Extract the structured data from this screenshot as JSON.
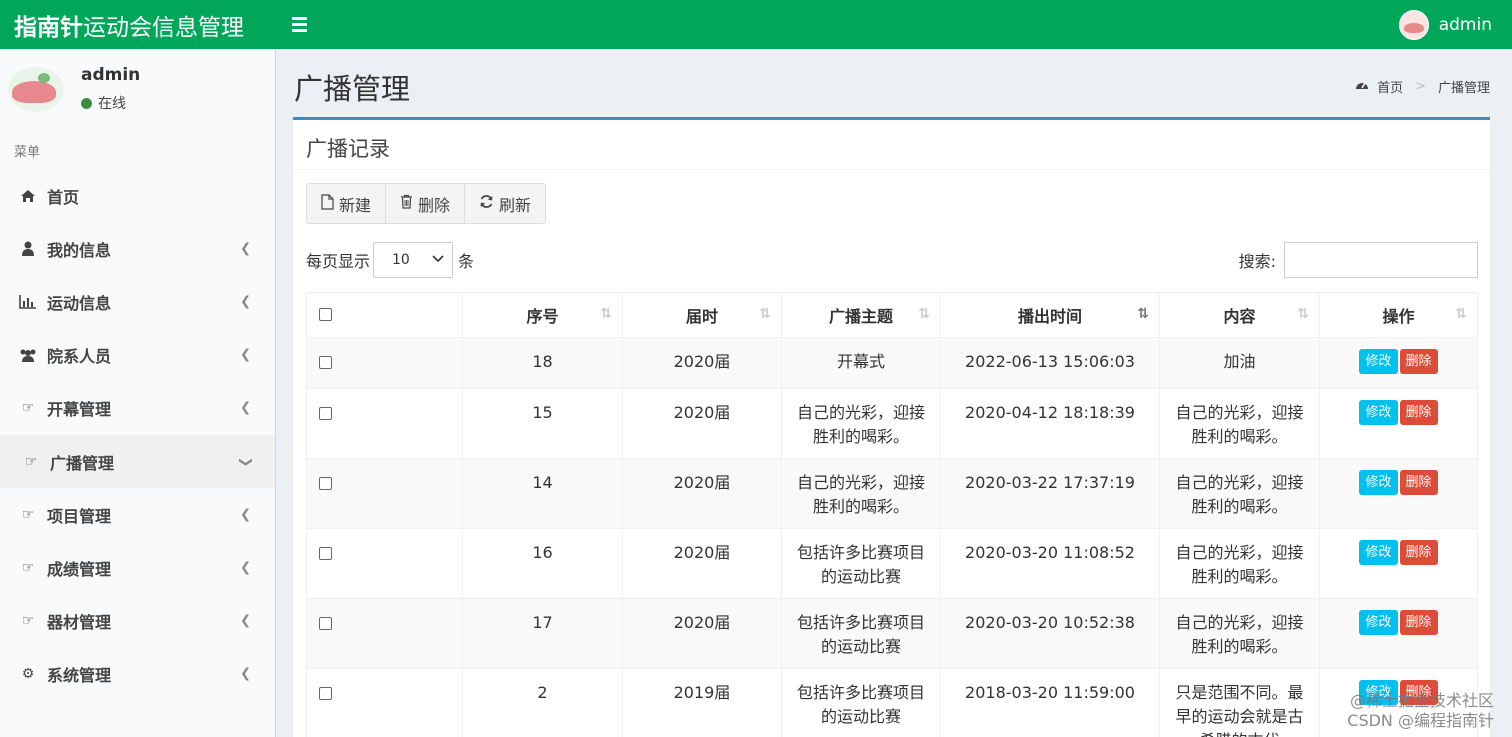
{
  "app": {
    "logo_bold": "指南针",
    "logo_rest": "运动会信息管理",
    "top_user": "admin"
  },
  "sidebar": {
    "user_name": "admin",
    "status": "在线",
    "menu_header": "菜单",
    "items": [
      {
        "label": "首页",
        "icon": "home-icon"
      },
      {
        "label": "我的信息",
        "icon": "user-icon"
      },
      {
        "label": "运动信息",
        "icon": "bar-chart-icon"
      },
      {
        "label": "院系人员",
        "icon": "users-icon"
      },
      {
        "label": "开幕管理",
        "icon": "hand-pointer-icon"
      },
      {
        "label": "广播管理",
        "icon": "hand-pointer-icon"
      },
      {
        "label": "项目管理",
        "icon": "hand-pointer-icon"
      },
      {
        "label": "成绩管理",
        "icon": "hand-pointer-icon"
      },
      {
        "label": "器材管理",
        "icon": "hand-pointer-icon"
      },
      {
        "label": "系统管理",
        "icon": "gear-icon"
      }
    ]
  },
  "page": {
    "title": "广播管理",
    "breadcrumb_home": "首页",
    "breadcrumb_current": "广播管理"
  },
  "box": {
    "title": "广播记录",
    "toolbar": {
      "new_label": "新建",
      "delete_label": "删除",
      "refresh_label": "刷新"
    },
    "length": {
      "prefix": "每页显示",
      "value": "10",
      "suffix": "条"
    },
    "search_label": "搜索:"
  },
  "table": {
    "columns": [
      "序号",
      "届时",
      "广播主题",
      "播出时间",
      "内容",
      "操作"
    ],
    "edit_label": "修改",
    "delete_label": "删除",
    "rows": [
      {
        "id": "18",
        "session": "2020届",
        "topic": "开幕式",
        "time": "2022-06-13 15:06:03",
        "content": "加油"
      },
      {
        "id": "15",
        "session": "2020届",
        "topic": "自己的光彩，迎接胜利的喝彩。",
        "time": "2020-04-12 18:18:39",
        "content": "自己的光彩，迎接胜利的喝彩。"
      },
      {
        "id": "14",
        "session": "2020届",
        "topic": "自己的光彩，迎接胜利的喝彩。",
        "time": "2020-03-22 17:37:19",
        "content": "自己的光彩，迎接胜利的喝彩。"
      },
      {
        "id": "16",
        "session": "2020届",
        "topic": "包括许多比赛项目的运动比赛",
        "time": "2020-03-20 11:08:52",
        "content": "自己的光彩，迎接胜利的喝彩。"
      },
      {
        "id": "17",
        "session": "2020届",
        "topic": "包括许多比赛项目的运动比赛",
        "time": "2020-03-20 10:52:38",
        "content": "自己的光彩，迎接胜利的喝彩。"
      },
      {
        "id": "2",
        "session": "2019届",
        "topic": "包括许多比赛项目的运动比赛",
        "time": "2018-03-20 11:59:00",
        "content": "只是范围不同。最早的运动会就是古希腊的古代"
      }
    ]
  },
  "watermark": {
    "line1": "@稀土掘金技术社区",
    "line2": "CSDN @编程指南针"
  },
  "colors": {
    "topbar": "#00a65a",
    "box_border": "#3c8dbc",
    "edit_button": "#00c0ef",
    "delete_button": "#dd4b39"
  }
}
